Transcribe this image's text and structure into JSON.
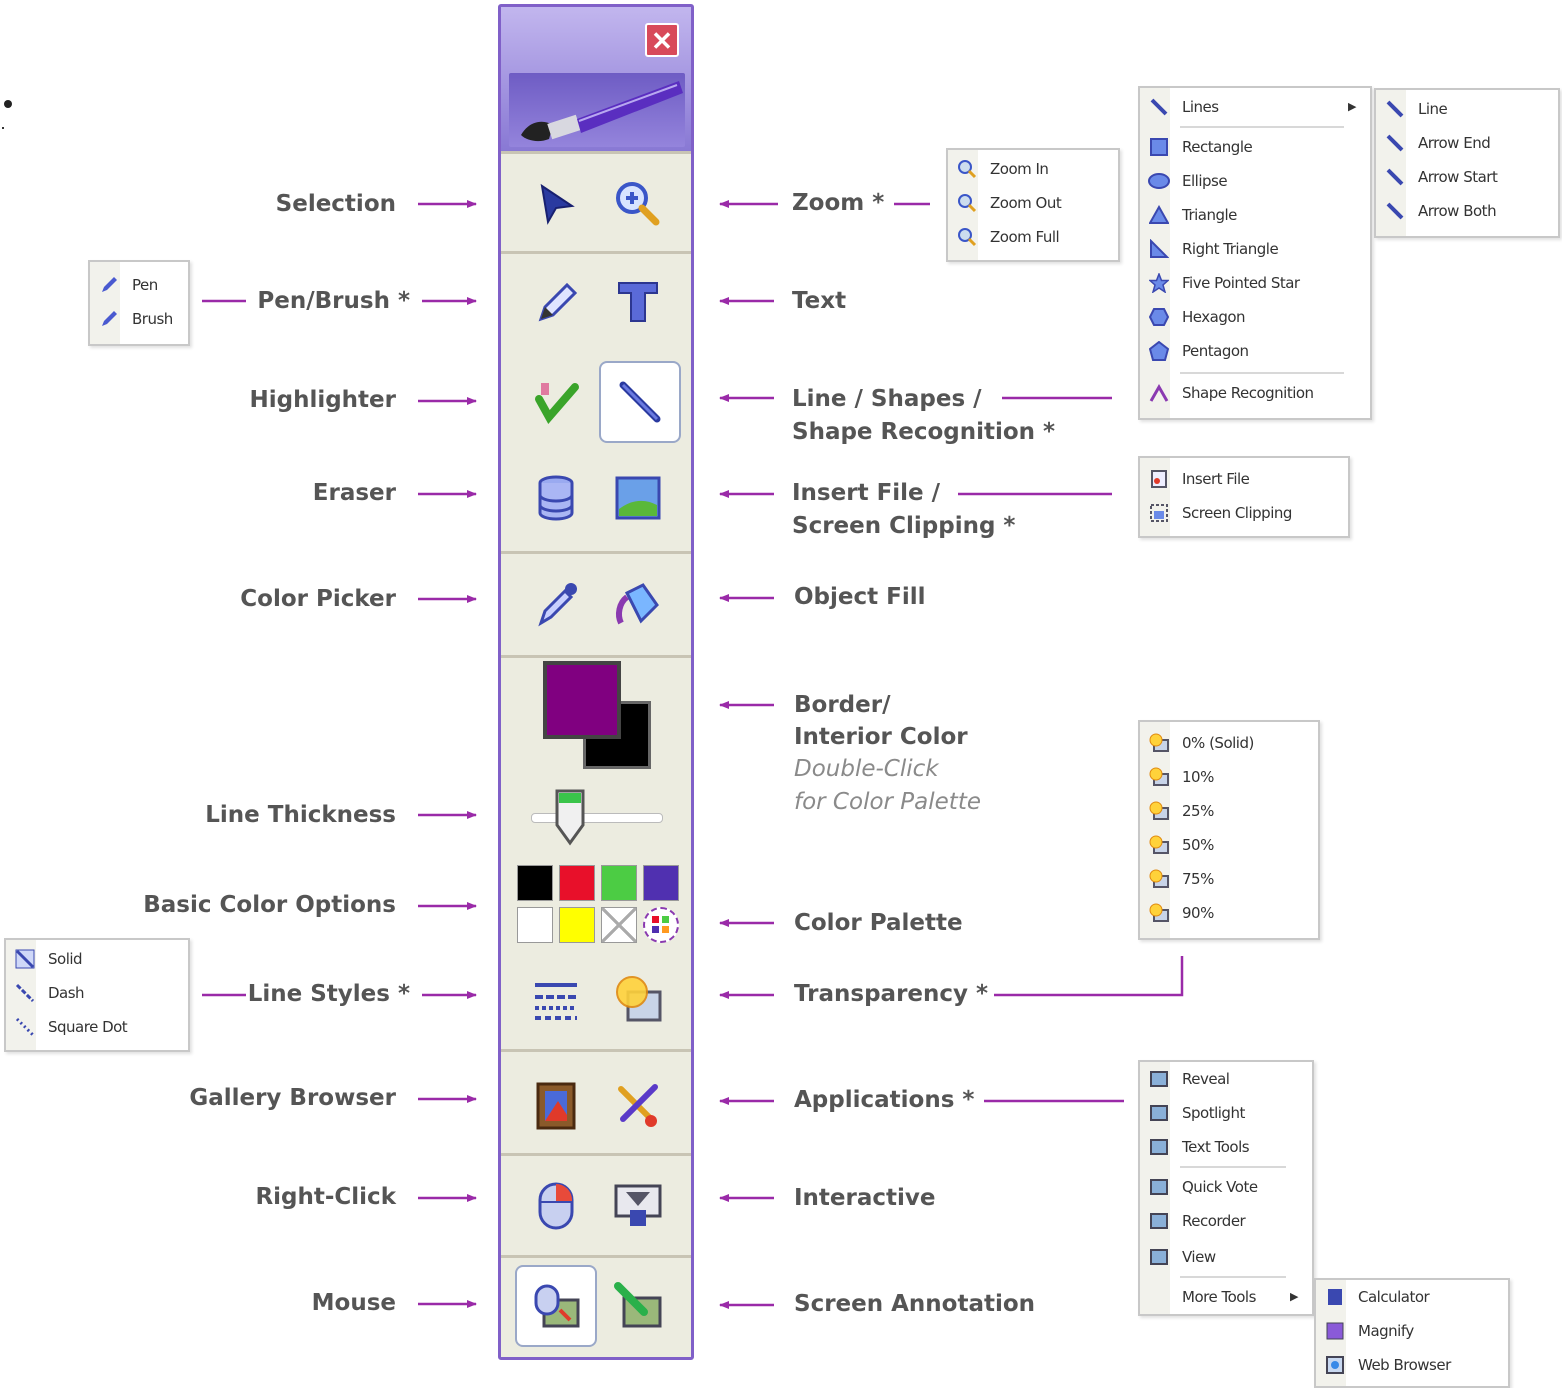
{
  "toolbar": {
    "close_icon": "close-icon",
    "header_icon": "paintbrush-icon",
    "accent_color": "#8060c8",
    "border_color": "#800080",
    "interior_color": "#000000",
    "line_thickness_level": 0.3,
    "basic_colors": [
      "#000000",
      "#e8102a",
      "#4ccc44",
      "#5030b0",
      "#ffffff",
      "#ffff00",
      "transparent",
      "palette"
    ]
  },
  "labels": {
    "left": {
      "selection": "Selection",
      "pen_brush": "Pen/Brush *",
      "highlighter": "Highlighter",
      "eraser": "Eraser",
      "color_picker": "Color Picker",
      "line_thickness": "Line Thickness",
      "basic_color_options": "Basic Color Options",
      "line_styles": "Line Styles *",
      "gallery_browser": "Gallery Browser",
      "right_click": "Right-Click",
      "mouse": "Mouse"
    },
    "right": {
      "zoom": "Zoom *",
      "text": "Text",
      "line_shapes_1": "Line / Shapes /",
      "line_shapes_2": "Shape Recognition *",
      "insert_file_1": "Insert File /",
      "insert_file_2": "Screen Clipping *",
      "object_fill": "Object Fill",
      "border_1": "Border/",
      "border_2": "Interior Color",
      "border_3": "Double-Click",
      "border_4": "for Color Palette",
      "color_palette": "Color Palette",
      "transparency": "Transparency *",
      "applications": "Applications *",
      "interactive": "Interactive",
      "screen_annotation": "Screen Annotation"
    }
  },
  "menus": {
    "pen_brush": [
      "Pen",
      "Brush"
    ],
    "zoom": [
      "Zoom In",
      "Zoom Out",
      "Zoom Full"
    ],
    "shapes": [
      "Lines",
      "Rectangle",
      "Ellipse",
      "Triangle",
      "Right Triangle",
      "Five Pointed Star",
      "Hexagon",
      "Pentagon",
      "Shape Recognition"
    ],
    "lines_sub": [
      "Line",
      "Arrow End",
      "Arrow Start",
      "Arrow Both"
    ],
    "insert_file": [
      "Insert File",
      "Screen Clipping"
    ],
    "transparency": [
      "0% (Solid)",
      "10%",
      "25%",
      "50%",
      "75%",
      "90%"
    ],
    "line_styles": [
      "Solid",
      "Dash",
      "Square Dot"
    ],
    "applications": [
      "Reveal",
      "Spotlight",
      "Text Tools",
      "Quick Vote",
      "Recorder",
      "View",
      "More Tools"
    ],
    "more_tools": [
      "Calculator",
      "Magnify",
      "Web Browser"
    ]
  }
}
